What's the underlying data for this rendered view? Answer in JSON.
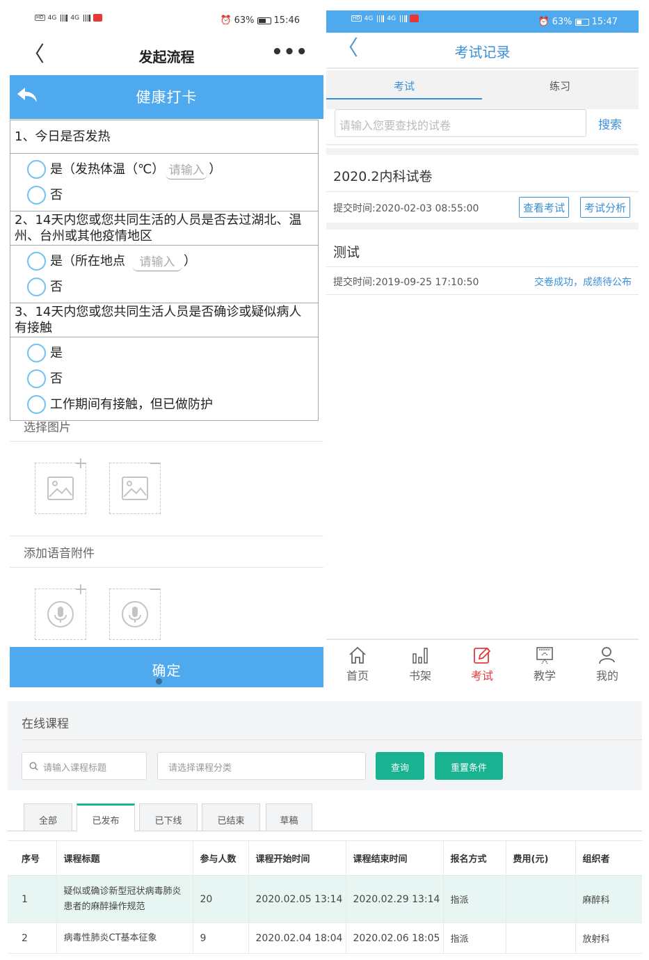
{
  "left_phone": {
    "status": {
      "time": "15:46",
      "battery": "63%",
      "network": "4G",
      "hd": "HD"
    },
    "nav": {
      "back": "〈",
      "title": "发起流程",
      "more": "•••"
    },
    "form_header": "健康打卡",
    "questions": [
      {
        "title": "1、今日是否发热",
        "options": [
          {
            "label_pre": "是（发热体温（℃）",
            "input_placeholder": "请输入",
            "label_post": "）"
          },
          {
            "label_pre": "否"
          }
        ]
      },
      {
        "title": "2、14天内您或您共同生活的人员是否去过湖北、温州、台州或其他疫情地区",
        "options": [
          {
            "label_pre": "是（所在地点",
            "input_placeholder": "请输入",
            "label_post": "）"
          },
          {
            "label_pre": "否"
          }
        ]
      },
      {
        "title": "3、14天内您或您共同生活人员是否确诊或疑似病人有接触",
        "options": [
          {
            "label_pre": "是"
          },
          {
            "label_pre": "否"
          },
          {
            "label_pre": "工作期间有接触，但已做防护"
          }
        ]
      }
    ],
    "select_image_label": "选择图片",
    "add_voice_label": "添加语音附件",
    "plus": "+",
    "minus": "−",
    "confirm": "确定"
  },
  "right_phone": {
    "status": {
      "time": "15:47",
      "battery": "63%",
      "network": "4G",
      "hd": "HD"
    },
    "nav": {
      "back": "〈",
      "title": "考试记录"
    },
    "tabs": [
      "考试",
      "练习"
    ],
    "search": {
      "placeholder": "请输入您要查找的试卷",
      "button": "搜索"
    },
    "records": [
      {
        "title": "2020.2内科试卷",
        "time": "提交时间:2020-02-03 08:55:00",
        "buttons": [
          "查看考试",
          "考试分析"
        ]
      },
      {
        "title": "测试",
        "time": "提交时间:2019-09-25 17:10:50",
        "status": "交卷成功，成绩待公布"
      }
    ],
    "tabbar": [
      {
        "label": "首页",
        "icon": "home-icon"
      },
      {
        "label": "书架",
        "icon": "bookshelf-icon"
      },
      {
        "label": "考试",
        "icon": "exam-icon",
        "active": true
      },
      {
        "label": "教学",
        "icon": "teaching-icon"
      },
      {
        "label": "我的",
        "icon": "user-icon"
      }
    ],
    "active_color": "#e4393c"
  },
  "web_panel": {
    "title": "在线课程",
    "course_title_placeholder": "请输入课程标题",
    "category_placeholder": "请选择课程分类",
    "query_button": "查询",
    "reset_button": "重置条件",
    "tabs": [
      "全部",
      "已发布",
      "已下线",
      "已结束",
      "草稿"
    ],
    "active_tab": "已发布",
    "columns": [
      "序号",
      "课程标题",
      "参与人数",
      "课程开始时间",
      "课程结束时间",
      "报名方式",
      "费用(元)",
      "组织者"
    ],
    "rows": [
      [
        "1",
        "疑似或确诊新型冠状病毒肺炎患者的麻醉操作规范",
        "20",
        "2020.02.05 13:14",
        "2020.02.29 13:14",
        "指派",
        "",
        "麻醉科"
      ],
      [
        "2",
        "病毒性肺炎CT基本征象",
        "9",
        "2020.02.04 18:04",
        "2020.02.06 18:05",
        "指派",
        "",
        "放射科"
      ]
    ],
    "accent": "#19b392"
  },
  "colors": {
    "primary_blue": "#4fa9ef",
    "link_blue": "#3a8fd9"
  }
}
